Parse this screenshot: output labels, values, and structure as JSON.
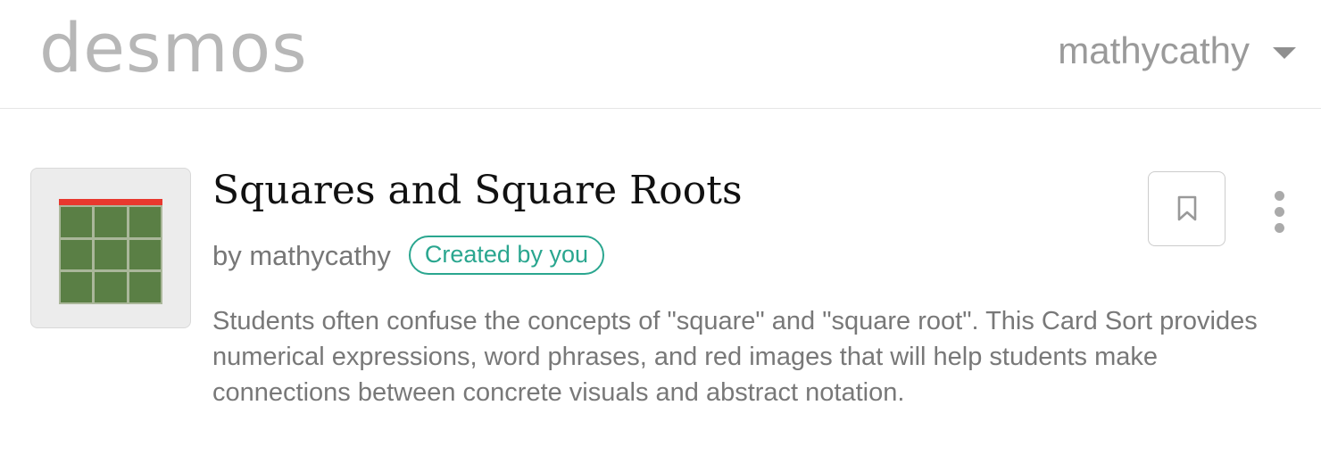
{
  "header": {
    "logo_text": "desmos",
    "username": "mathycathy",
    "menu_icon": "chevron-down-icon"
  },
  "activity": {
    "title": "Squares and Square Roots",
    "author": "by mathycathy",
    "badge": "Created by you",
    "badge_color": "#2aa68f",
    "description": "Students often confuse the concepts of \"square\" and \"square root\".  This Card Sort provides numerical expressions, word phrases, and red images that will help students make connections between concrete visuals and abstract notation.",
    "thumbnail": {
      "icon": "square-grid-icon",
      "bar_color": "#e8382e",
      "grid_color": "#5a7f45"
    },
    "actions": {
      "bookmark_icon": "bookmark-icon",
      "more_icon": "more-vertical-icon"
    }
  }
}
